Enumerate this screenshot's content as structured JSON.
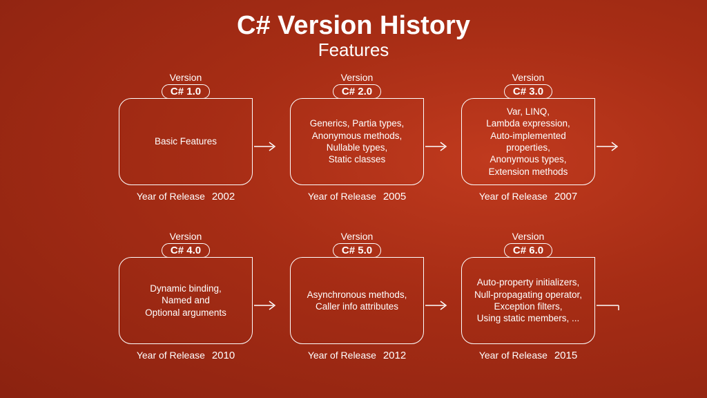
{
  "header": {
    "title": "C# Version History",
    "subtitle": "Features"
  },
  "labels": {
    "version": "Version",
    "year_of_release": "Year of Release"
  },
  "versions": [
    {
      "name": "C# 1.0",
      "year": "2002",
      "features": "Basic Features"
    },
    {
      "name": "C# 2.0",
      "year": "2005",
      "features": "Generics, Partia types,\nAnonymous methods,\nNullable types,\nStatic classes"
    },
    {
      "name": "C# 3.0",
      "year": "2007",
      "features": "Var, LINQ,\nLambda expression,\nAuto-implemented properties,\nAnonymous types,\nExtension methods"
    },
    {
      "name": "C# 4.0",
      "year": "2010",
      "features": "Dynamic binding,\nNamed and\nOptional arguments"
    },
    {
      "name": "C# 5.0",
      "year": "2012",
      "features": "Asynchronous methods,\nCaller info attributes"
    },
    {
      "name": "C# 6.0",
      "year": "2015",
      "features": "Auto-property initializers,\nNull-propagating operator,\nException filters,\nUsing static members, ..."
    }
  ]
}
